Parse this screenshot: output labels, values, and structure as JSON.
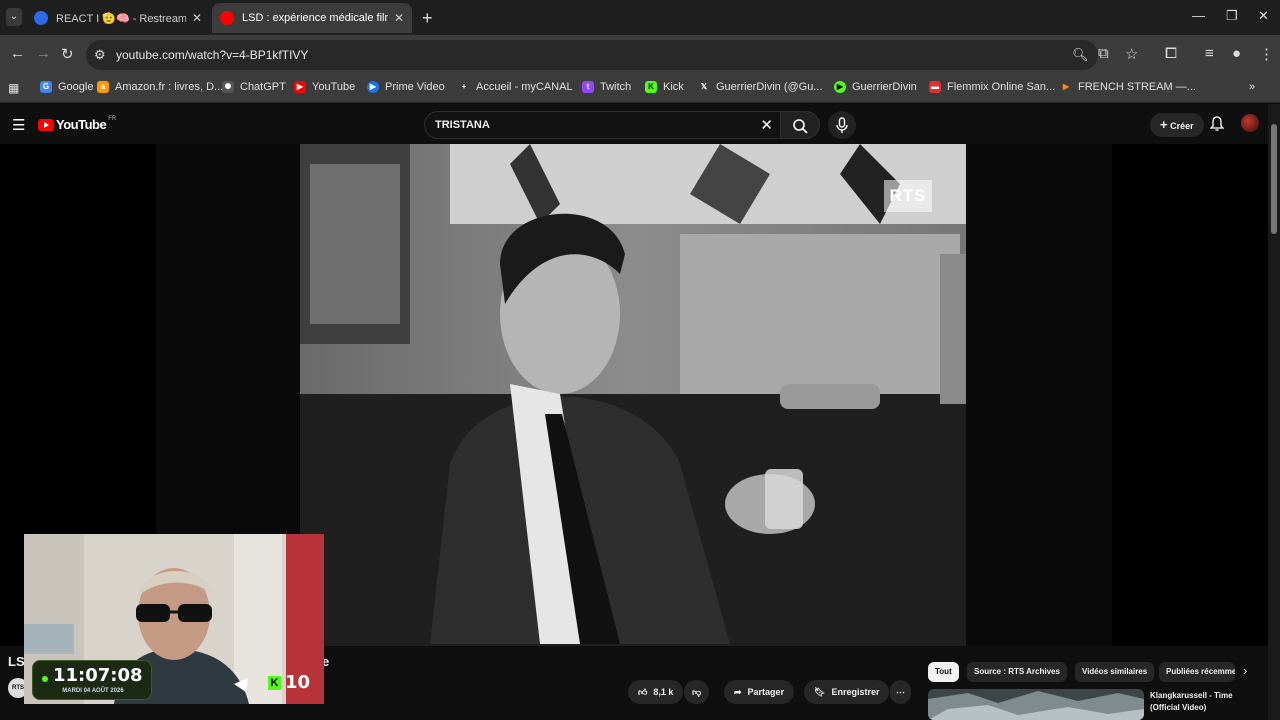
{
  "browser": {
    "tabs": [
      {
        "title": "REACT I 🫡🧠 - Restream",
        "active": false
      },
      {
        "title": "LSD : expérience médicale filmée",
        "active": true
      }
    ],
    "url": "youtube.com/watch?v=4-BP1kfTIVY",
    "bookmarks": [
      {
        "label": "Google",
        "color": "#ffffff"
      },
      {
        "label": "Amazon.fr : livres, D...",
        "color": "#ff9900"
      },
      {
        "label": "ChatGPT",
        "color": "#ffffff"
      },
      {
        "label": "YouTube",
        "color": "#ff0000"
      },
      {
        "label": "Prime Video",
        "color": "#1a73e8"
      },
      {
        "label": "Accueil - myCANAL",
        "color": "#ffffff"
      },
      {
        "label": "Twitch",
        "color": "#9146ff"
      },
      {
        "label": "Kick",
        "color": "#53fc18"
      },
      {
        "label": "GuerrierDivin (@Gu...",
        "color": "#ffffff"
      },
      {
        "label": "GuerrierDivin",
        "color": "#53fc18"
      },
      {
        "label": "Flemmix Online San...",
        "color": "#e03030"
      },
      {
        "label": "FRENCH STREAM —...",
        "color": "#ff8c00"
      }
    ]
  },
  "youtube": {
    "logo_region": "FR",
    "search_value": "TRISTANA",
    "create_label": "Créer",
    "video_watermark": "RTS",
    "title_start": "LSD",
    "title_end": "e",
    "channel_avatar_text": "RTS",
    "actions": {
      "likes": "8,1 k",
      "share": "Partager",
      "save": "Enregistrer"
    },
    "chips": [
      "Tout",
      "Source : RTS Archives",
      "Vidéos similaires",
      "Publiées récemment"
    ],
    "recommendation_title": "Klangkarussell - Time (Official Video)"
  },
  "overlay": {
    "time": "11:07:08",
    "date": "MARDI 04 AOÛT 2026",
    "kick_count": "10"
  },
  "colors": {
    "youtube_red": "#ff0000",
    "kick_green": "#53fc18"
  }
}
